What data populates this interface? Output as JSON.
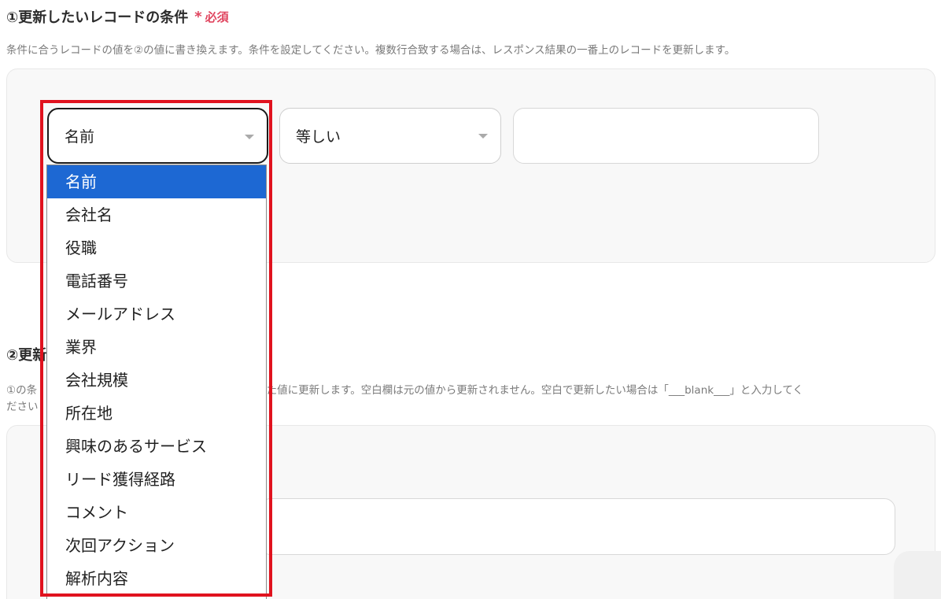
{
  "section1": {
    "title": "①更新したいレコードの条件",
    "required_mark": "*",
    "required_label": "必須",
    "description": "条件に合うレコードの値を②の値に書き換えます。条件を設定してください。複数行合致する場合は、レスポンス結果の一番上のレコードを更新します。",
    "field_select_value": "名前",
    "operator_select_value": "等しい",
    "value_input": ""
  },
  "dropdown": {
    "options": [
      "名前",
      "会社名",
      "役職",
      "電話番号",
      "メールアドレス",
      "業界",
      "会社規模",
      "所在地",
      "興味のあるサービス",
      "リード獲得経路",
      "コメント",
      "次回アクション",
      "解析内容"
    ],
    "selected_index": 0
  },
  "section2": {
    "title": "②更新",
    "description_visible_tail": "した値に更新します。空白欄は元の値から更新されません。空白で更新したい場合は「___blank___」と入力してく",
    "description_prefix": "①の条",
    "description_line2": "ださい",
    "value_input": ""
  },
  "colors": {
    "required": "#e0455f",
    "selected_option_bg": "#1d68d3",
    "highlight_border": "#e0121e",
    "panel_bg": "#f8f8f8"
  },
  "icons": {
    "caret": "chevron-down-icon"
  }
}
